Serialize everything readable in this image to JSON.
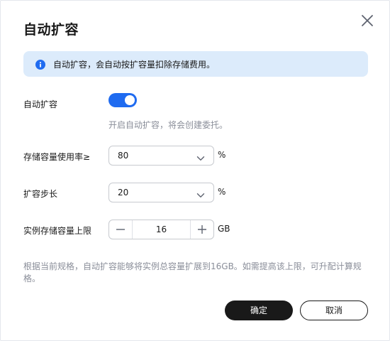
{
  "dialog": {
    "title": "自动扩容",
    "close_icon": "close-icon"
  },
  "notice": {
    "icon": "info-icon",
    "text": "自动扩容，会自动按扩容量扣除存储费用。"
  },
  "auto_expand": {
    "label": "自动扩容",
    "enabled": true,
    "hint": "开启自动扩容，将会创建委托。"
  },
  "usage_threshold": {
    "label": "存储容量使用率≥",
    "value": "80",
    "unit": "%"
  },
  "step": {
    "label": "扩容步长",
    "value": "20",
    "unit": "%"
  },
  "limit": {
    "label": "实例存储容量上限",
    "value": "16",
    "unit": "GB"
  },
  "description": "根据当前规格，自动扩容能够将实例总容量扩展到16GB。如需提高该上限，可升配计算规格。",
  "footer": {
    "ok_label": "确定",
    "cancel_label": "取消"
  },
  "colors": {
    "accent": "#1f6bf0",
    "notice_bg": "#dcebfb",
    "primary_button": "#191919"
  }
}
